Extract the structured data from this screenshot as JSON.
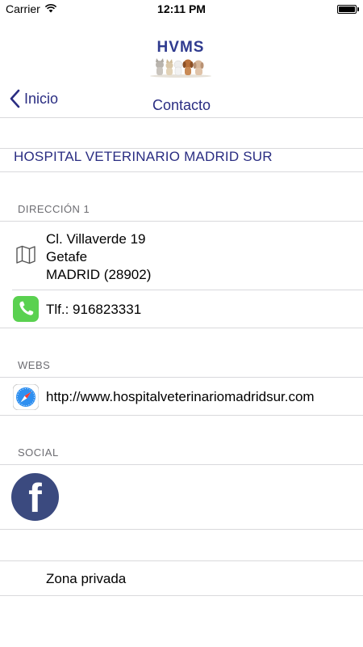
{
  "status_bar": {
    "carrier": "Carrier",
    "time": "12:11 PM"
  },
  "logo": {
    "text": "HVMS"
  },
  "nav": {
    "back_label": "Inicio",
    "title": "Contacto"
  },
  "hospital_name": "HOSPITAL VETERINARIO MADRID SUR",
  "address_section": {
    "header": "DIRECCIÓN 1",
    "line1": "Cl. Villaverde 19",
    "line2": "Getafe",
    "line3": "MADRID (28902)",
    "phone": "Tlf.: 916823331"
  },
  "webs_section": {
    "header": "WEBS",
    "url": "http://www.hospitalveterinariomadridsur.com"
  },
  "social_section": {
    "header": "SOCIAL",
    "facebook_glyph": "f"
  },
  "private_zone": "Zona privada",
  "colors": {
    "nav_tint": "#2a2d82",
    "separator": "#d9d9dc",
    "section_header": "#6d6d72",
    "phone_green": "#5ad150",
    "facebook_blue": "#3b4a7f"
  },
  "icons": [
    "wifi-icon",
    "battery-icon",
    "chevron-left-icon",
    "map-icon",
    "phone-icon",
    "safari-icon",
    "facebook-icon"
  ]
}
